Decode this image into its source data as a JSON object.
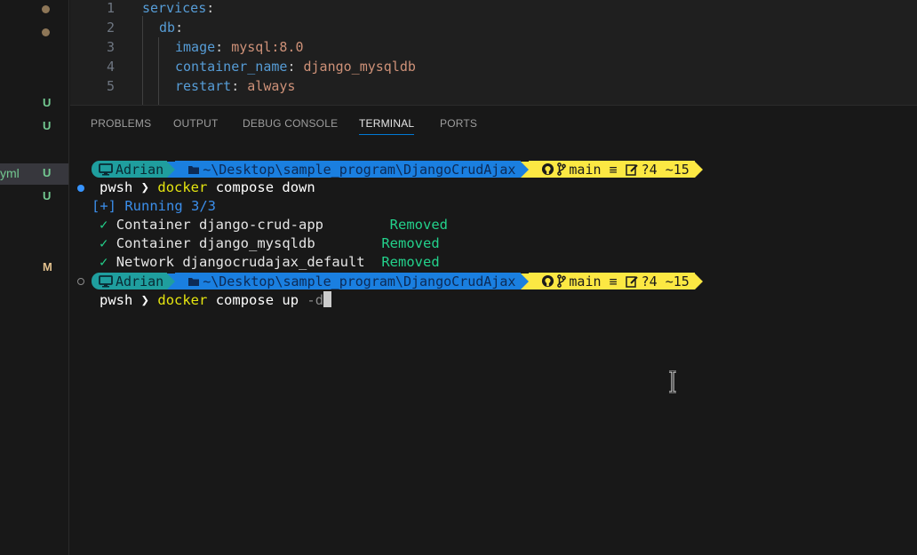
{
  "sidebar": {
    "items": [
      {
        "name": "",
        "status": "●",
        "kind": "dot"
      },
      {
        "name": "",
        "status": "●",
        "kind": "dot"
      },
      {
        "name": "",
        "status": "U",
        "kind": "u"
      },
      {
        "name": "",
        "status": "U",
        "kind": "u"
      },
      {
        "name": "yml",
        "status": "U",
        "kind": "u"
      },
      {
        "name": "",
        "status": "U",
        "kind": "u"
      },
      {
        "name": "",
        "status": "M",
        "kind": "m"
      }
    ]
  },
  "editor": {
    "lines": [
      {
        "num": "1",
        "key": "services",
        "colon": ":",
        "value": ""
      },
      {
        "num": "2",
        "key": "db",
        "colon": ":",
        "value": ""
      },
      {
        "num": "3",
        "key": "image",
        "colon": ": ",
        "value": "mysql:8.0"
      },
      {
        "num": "4",
        "key": "container_name",
        "colon": ": ",
        "value": "django_mysqldb"
      },
      {
        "num": "5",
        "key": "restart",
        "colon": ": ",
        "value": "always"
      }
    ]
  },
  "panel": {
    "tabs": [
      "PROBLEMS",
      "OUTPUT",
      "DEBUG CONSOLE",
      "TERMINAL",
      "PORTS"
    ],
    "active_tab": "TERMINAL"
  },
  "terminal": {
    "prompt": {
      "user": "Adrian",
      "path": "~\\Desktop\\sample_program\\DjangoCrudAjax",
      "branch": "main",
      "branch_status": "≡",
      "changes": "?4 ~15"
    },
    "shell": "pwsh",
    "command1": {
      "cmd": "docker",
      "args": "compose down"
    },
    "running": "[+] Running 3/3",
    "results": [
      {
        "text": "Container django-crud-app      ",
        "status": "Removed"
      },
      {
        "text": "Container django_mysqldb      ",
        "status": "Removed"
      },
      {
        "text": "Network djangocrudajax_default",
        "status": "Removed"
      }
    ],
    "command2": {
      "cmd": "docker",
      "args": "compose up",
      "flag": "-d"
    }
  },
  "colors": {
    "accent": "#0078d4",
    "user_segment": "#1f9e9e",
    "path_segment": "#1a7fe0",
    "git_segment": "#fce843",
    "success": "#23d18b"
  },
  "icons": [
    "monitor-icon",
    "folder-icon",
    "github-icon",
    "branch-icon",
    "edit-icon",
    "check-icon",
    "text-cursor-icon"
  ]
}
